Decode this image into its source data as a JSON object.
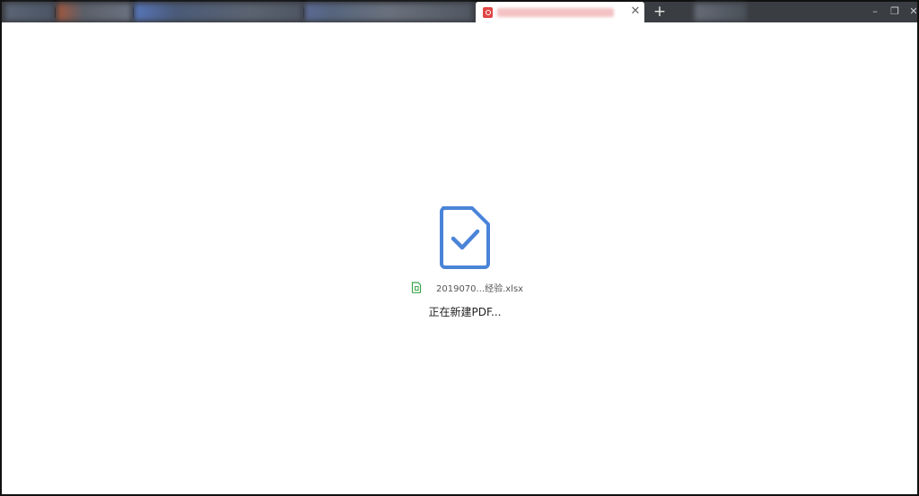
{
  "browser": {
    "active_tab": {
      "title": "",
      "icon": "pdf-icon",
      "close_symbol": "✕"
    },
    "new_tab_symbol": "+",
    "window_controls": {
      "minimize": "–",
      "maximize": "❐",
      "close": "✕"
    }
  },
  "main": {
    "status_icon": "document-check-icon",
    "file_icon": "excel-file-icon",
    "file_name": "2019070...经验.xlsx",
    "status_text": "正在新建PDF...",
    "accent_color": "#4a84d8",
    "excel_color": "#3aa54a"
  }
}
